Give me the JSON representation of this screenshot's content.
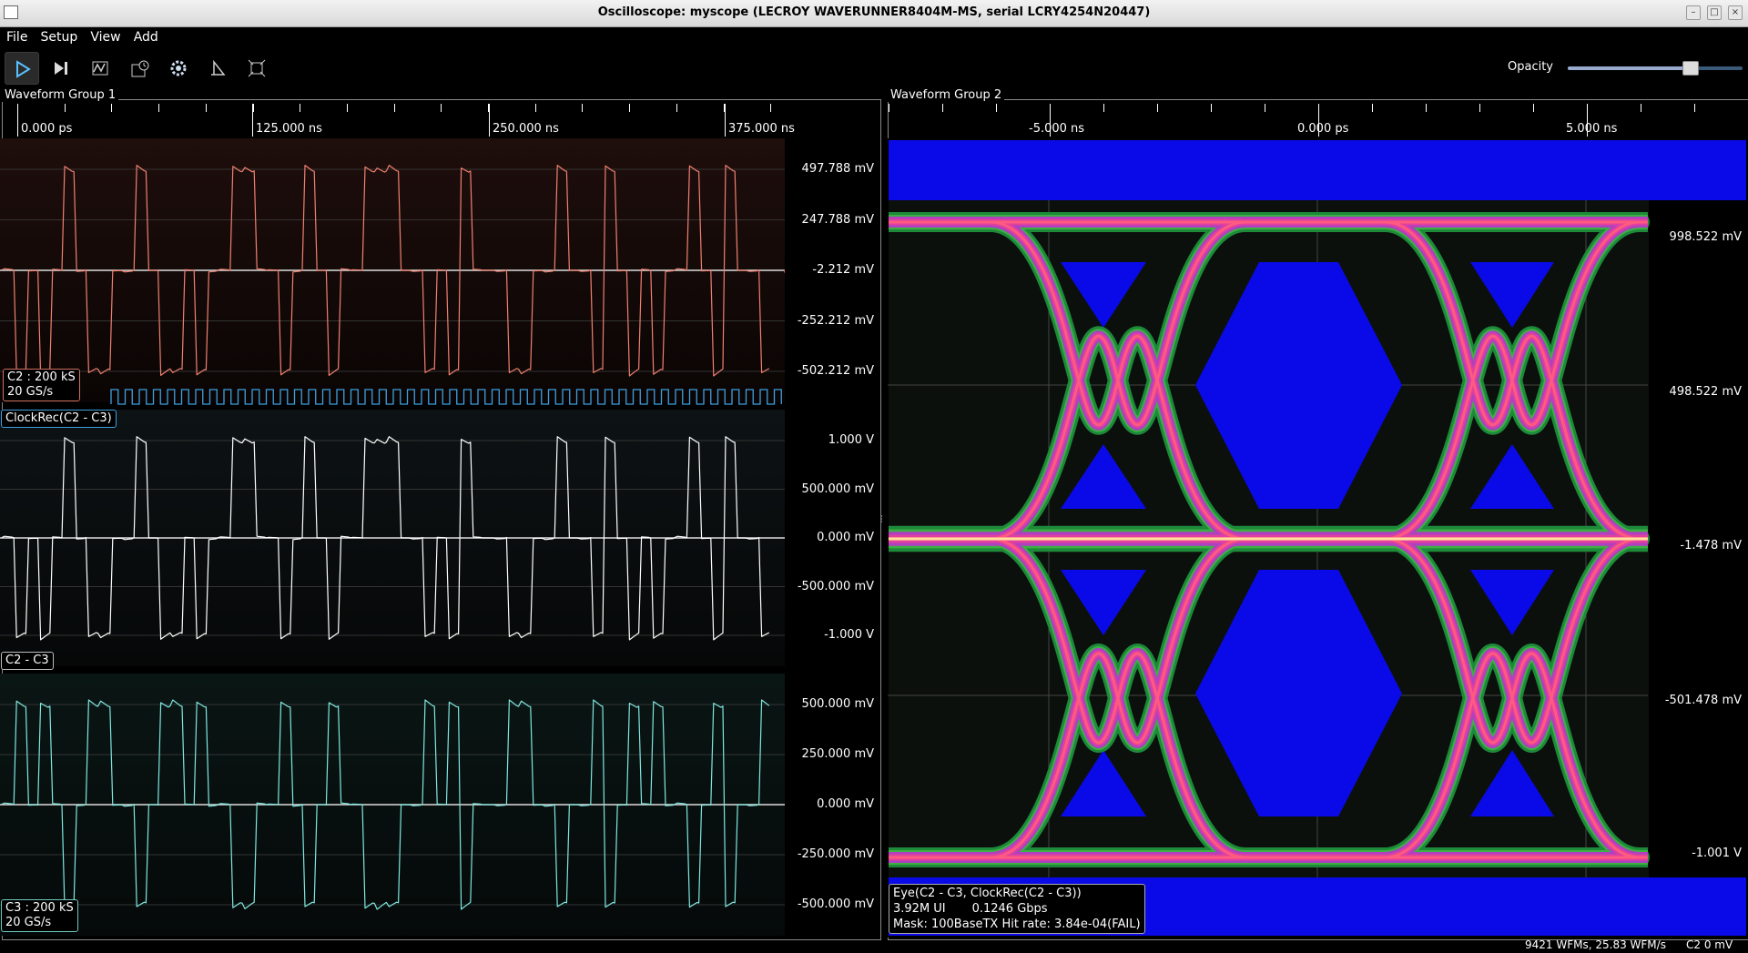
{
  "window": {
    "title": "Oscilloscope: myscope (LECROY WAVERUNNER8404M-MS, serial LCRY4254N20447)"
  },
  "menu": [
    "File",
    "Setup",
    "View",
    "Add"
  ],
  "toolbar": {
    "buttons": [
      "start-trigger-icon",
      "single-trigger-icon",
      "waveform-icon",
      "history-icon",
      "settings-gear-icon",
      "triangle-math-icon",
      "fit-zoom-icon"
    ],
    "opacity_label": "Opacity",
    "opacity_value": 0.7
  },
  "group1": {
    "label": "Waveform Group 1",
    "time_ticks": [
      "0.000 ps",
      "125.000 ns",
      "250.000 ns",
      "375.000 ns"
    ],
    "panels": [
      {
        "name": "C2",
        "color": "#f08070",
        "box_lines": [
          "C2 : 200 kS",
          "20 GS/s"
        ],
        "v_labels": [
          "497.788 mV",
          "247.788 mV",
          "-2.212 mV",
          "-252.212 mV",
          "-502.212 mV"
        ]
      },
      {
        "name": "C2 - C3",
        "color": "#ffffff",
        "box_lines": [
          "C2 - C3"
        ],
        "clock_label": "ClockRec(C2 - C3)",
        "clock_color": "#3fa0e0",
        "v_labels": [
          "1.000 V",
          "500.000 mV",
          "0.000 mV",
          "-500.000 mV",
          "-1.000 V"
        ]
      },
      {
        "name": "C3",
        "color": "#7fe8e0",
        "box_lines": [
          "C3 : 200 kS",
          "20 GS/s"
        ],
        "v_labels": [
          "500.000 mV",
          "250.000 mV",
          "0.000 mV",
          "-250.000 mV",
          "-500.000 mV"
        ]
      }
    ]
  },
  "group2": {
    "label": "Waveform Group 2",
    "time_ticks": [
      "-5.000 ns",
      "0.000 ps",
      "5.000 ns"
    ],
    "v_labels": [
      "998.522 mV",
      "498.522 mV",
      "-1.478 mV",
      "-501.478 mV",
      "-1.001 V"
    ],
    "eye_box_lines": [
      "Eye(C2 - C3, ClockRec(C2 - C3))",
      "3.92M UI       0.1246 Gbps",
      "Mask: 100BaseTX   Hit rate: 3.84e-04(FAIL)"
    ],
    "mask_color": "#0a0ae8"
  },
  "status": {
    "wfms": "9421 WFMs, 25.83 WFM/s",
    "cursor": "C2 0 mV"
  }
}
